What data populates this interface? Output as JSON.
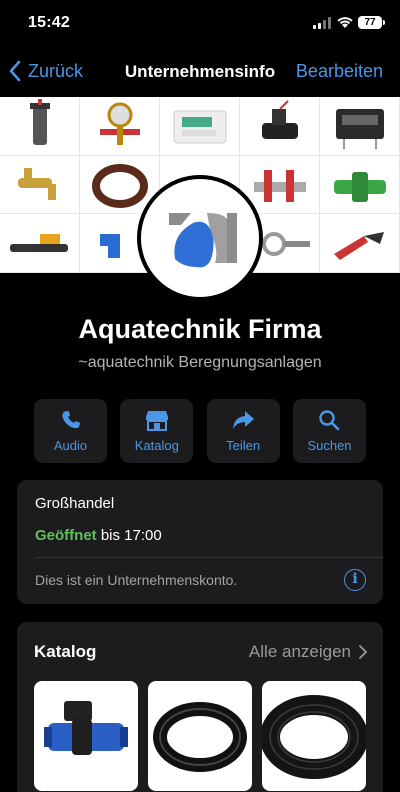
{
  "status_bar": {
    "time": "15:42",
    "battery": "77"
  },
  "nav": {
    "back_label": "Zurück",
    "title": "Unternehmensinfo",
    "edit_label": "Bearbeiten"
  },
  "profile": {
    "name": "Aquatechnik Firma",
    "subtitle": "~aquatechnik Beregnungsanlagen"
  },
  "actions": [
    {
      "label": "Audio",
      "icon": "phone-icon"
    },
    {
      "label": "Katalog",
      "icon": "storefront-icon"
    },
    {
      "label": "Teilen",
      "icon": "share-arrow-icon"
    },
    {
      "label": "Suchen",
      "icon": "search-icon"
    }
  ],
  "info": {
    "category": "Großhandel",
    "open_status": "Geöffnet",
    "hours": "bis 17:00",
    "business_note": "Dies ist ein Unternehmenskonto."
  },
  "catalog": {
    "heading": "Katalog",
    "see_all": "Alle anzeigen"
  },
  "colors": {
    "accent": "#4b96e6",
    "open_green": "#5fc05b",
    "card_bg": "#1c1c1e",
    "logo_blue": "#2f6fd6"
  }
}
